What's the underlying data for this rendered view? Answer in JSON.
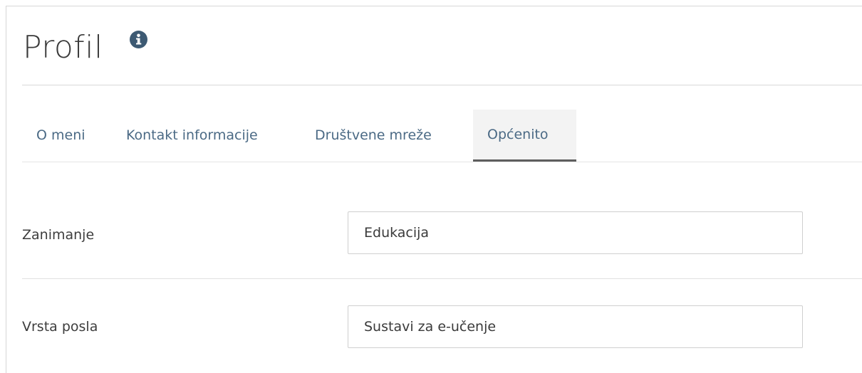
{
  "header": {
    "title": "Profil",
    "info_icon": "info-circle-icon"
  },
  "tabs": [
    {
      "label": "O meni",
      "active": false
    },
    {
      "label": "Kontakt informacije",
      "active": false
    },
    {
      "label": "Društvene mreže",
      "active": false
    },
    {
      "label": "Općenito",
      "active": true
    }
  ],
  "form": {
    "occupation": {
      "label": "Zanimanje",
      "value": "Edukacija"
    },
    "job_type": {
      "label": "Vrsta posla",
      "value": "Sustavi za e-učenje"
    }
  },
  "colors": {
    "tab_text": "#4b6a85",
    "active_tab_bg": "#f3f3f3",
    "active_tab_underline": "#5e5e5e",
    "info_icon": "#3d5a73"
  }
}
